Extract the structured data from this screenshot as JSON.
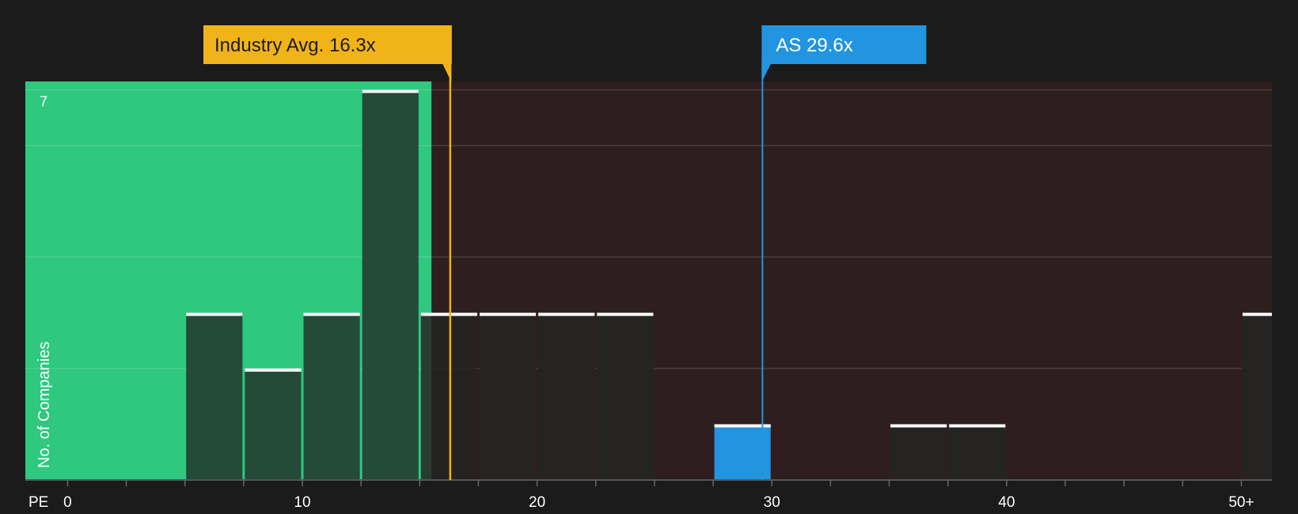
{
  "chart_data": {
    "type": "bar",
    "x_axis_label": "PE",
    "y_axis_label": "No. of Companies",
    "x_ticks": [
      {
        "value": 0,
        "label": "0"
      },
      {
        "value": 10,
        "label": "10"
      },
      {
        "value": 20,
        "label": "20"
      },
      {
        "value": 30,
        "label": "30"
      },
      {
        "value": 40,
        "label": "40"
      },
      {
        "value": 50,
        "label": "50+"
      }
    ],
    "x_range": [
      -1.8,
      51.3
    ],
    "y_range": [
      0,
      7.15
    ],
    "y_gridlines": [
      2,
      4,
      6,
      7
    ],
    "y_tick_labels": [
      {
        "value": 7,
        "label": "7"
      }
    ],
    "bin_width": 2.5,
    "bars": [
      {
        "x_start": 5.0,
        "value": 3
      },
      {
        "x_start": 7.5,
        "value": 2
      },
      {
        "x_start": 10.0,
        "value": 3
      },
      {
        "x_start": 12.5,
        "value": 7
      },
      {
        "x_start": 15.0,
        "value": 3
      },
      {
        "x_start": 17.5,
        "value": 3
      },
      {
        "x_start": 20.0,
        "value": 3
      },
      {
        "x_start": 22.5,
        "value": 3
      },
      {
        "x_start": 27.5,
        "value": 1,
        "highlight": true
      },
      {
        "x_start": 35.0,
        "value": 1
      },
      {
        "x_start": 37.5,
        "value": 1
      },
      {
        "x_start": 50.0,
        "value": 3
      }
    ],
    "fair_zone_end": 15.5,
    "industry_avg": {
      "value": 16.3,
      "label": "Industry Avg. 16.3x"
    },
    "company": {
      "value": 29.6,
      "label": "AS 29.6x"
    },
    "colors": {
      "background": "#1b1b1b",
      "fair_zone": "#2ec87f",
      "expensive_zone": "#2e1e1f",
      "bar_dark": "#244a38",
      "bar_neutral": "#262323",
      "bar_cap": "#ffffff",
      "highlight": "#2394e0",
      "industry_avg": "#f0b31a"
    }
  }
}
